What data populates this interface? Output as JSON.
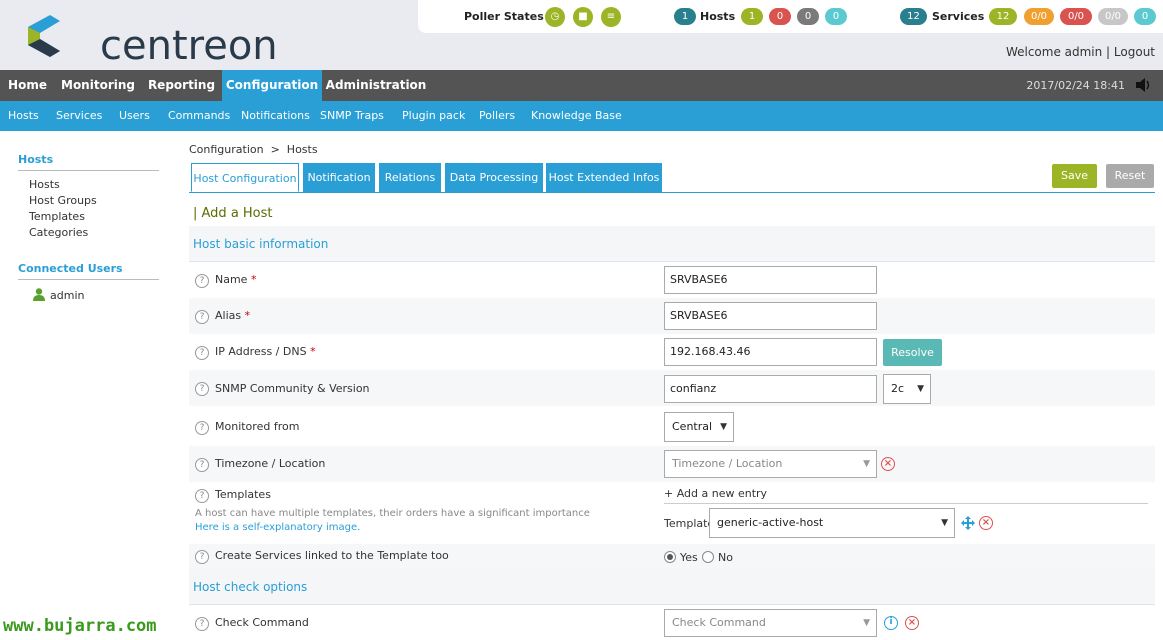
{
  "header": {
    "logo_text": "centreon",
    "poller_label": "Poller States",
    "hosts_count": "1",
    "hosts_label": "Hosts",
    "hosts_up": "1",
    "hosts_down": "0",
    "hosts_unreachable": "0",
    "hosts_pending": "0",
    "services_count": "12",
    "services_label": "Services",
    "services_ok": "12",
    "services_warning": "0/0",
    "services_critical": "0/0",
    "services_unknown": "0/0",
    "services_pending": "0",
    "welcome": "Welcome admin | Logout"
  },
  "mainnav": {
    "items": [
      "Home",
      "Monitoring",
      "Reporting",
      "Configuration",
      "Administration"
    ],
    "active": "Configuration",
    "datetime": "2017/02/24 18:41"
  },
  "subnav": {
    "items": [
      "Hosts",
      "Services",
      "Users",
      "Commands",
      "Notifications",
      "SNMP Traps",
      "Plugin pack",
      "Pollers",
      "Knowledge Base"
    ]
  },
  "sidebar": {
    "hosts_head": "Hosts",
    "hosts_items": [
      "Hosts",
      "Host Groups",
      "Templates",
      "Categories"
    ],
    "users_head": "Connected Users",
    "user": "admin"
  },
  "content": {
    "breadcrumb": "Configuration  >  Hosts",
    "tabs": [
      "Host Configuration",
      "Notification",
      "Relations",
      "Data Processing",
      "Host Extended Infos"
    ],
    "save": "Save",
    "reset": "Reset",
    "title": "| Add a Host",
    "section_basic": "Host basic information",
    "section_check": "Host check options",
    "fields": {
      "name_label": "Name",
      "name_value": "SRVBASE6",
      "alias_label": "Alias",
      "alias_value": "SRVBASE6",
      "ip_label": "IP Address / DNS",
      "ip_value": "192.168.43.46",
      "resolve": "Resolve",
      "snmp_label": "SNMP Community & Version",
      "snmp_value": "confianz",
      "snmp_version": "2c",
      "monitored_label": "Monitored from",
      "monitored_value": "Central",
      "timezone_label": "Timezone / Location",
      "timezone_placeholder": "Timezone / Location",
      "templates_label": "Templates",
      "add_entry": "+ Add a new entry",
      "templates_note": "A host can have multiple templates, their orders have a significant importance",
      "templates_link": "Here is a self-explanatory image.",
      "template_label": "Template",
      "template_value": "generic-active-host",
      "create_services_label": "Create Services linked to the Template too",
      "yes": "Yes",
      "no": "No",
      "check_command_label": "Check Command",
      "check_command_placeholder": "Check Command"
    },
    "required_mark": "*",
    "help_mark": "?"
  },
  "watermark": "www.bujarra.com",
  "colors": {
    "accent": "#2a9fd6",
    "ok": "#9cb526",
    "critical": "#d9534f",
    "warning": "#f0a030",
    "nav": "#545454"
  }
}
